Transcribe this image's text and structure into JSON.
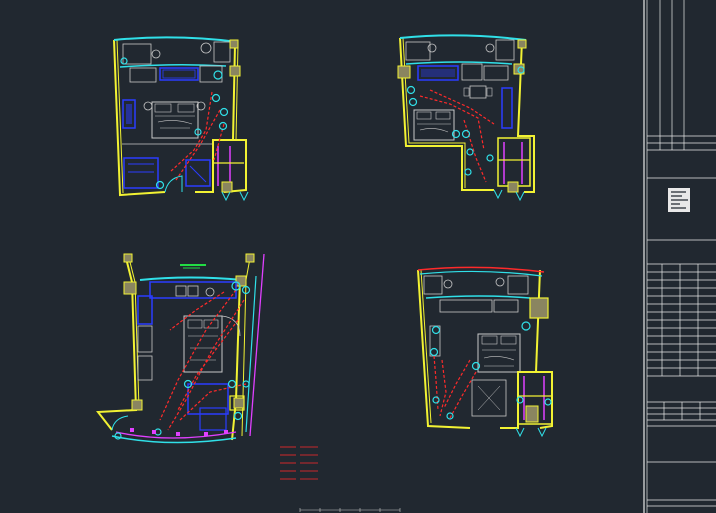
{
  "drawing": {
    "background": "#212830",
    "colors": {
      "wall": "#f2f233",
      "glass": "#30e0e8",
      "furniture": "#c8c8c8",
      "bath": "#2a3cff",
      "circuit": "#ff2a2a",
      "partition": "#e040ff",
      "column": "#b8b070",
      "mark": "#22dd44",
      "frame": "#e8e8e8"
    },
    "plans": [
      {
        "name": "unit-plan-top-left"
      },
      {
        "name": "unit-plan-top-right"
      },
      {
        "name": "unit-plan-bottom-left"
      },
      {
        "name": "unit-plan-bottom-right"
      }
    ],
    "legend_rows": 5,
    "title_block": {
      "has_logo": true
    }
  }
}
